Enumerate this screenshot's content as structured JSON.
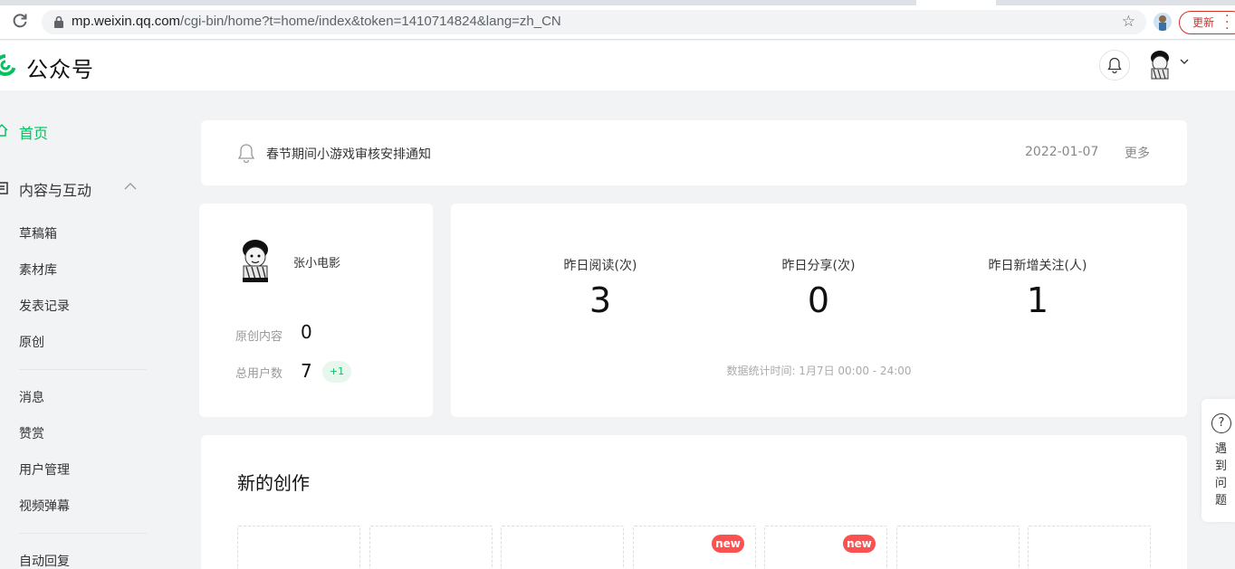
{
  "browser": {
    "url_host": "mp.weixin.qq.com",
    "url_rest": "/cgi-bin/home?t=home/index&token=1410714824&lang=zh_CN",
    "update_label": "更新"
  },
  "header": {
    "app_name": "公众号"
  },
  "sidebar": {
    "home": "首页",
    "group_title": "内容与互动",
    "items_group1": [
      "草稿箱",
      "素材库",
      "发表记录",
      "原创"
    ],
    "items_group2": [
      "消息",
      "赞赏",
      "用户管理",
      "视频弹幕"
    ],
    "items_group3": [
      "自动回复"
    ]
  },
  "notice": {
    "title": "春节期间小游戏审核安排通知",
    "date": "2022-01-07",
    "more_label": "更多"
  },
  "account": {
    "name": "张小电影",
    "original_label": "原创内容",
    "original_value": "0",
    "users_label": "总用户数",
    "users_value": "7",
    "users_delta": "+1"
  },
  "stats": {
    "items": [
      {
        "label": "昨日阅读(次)",
        "value": "3"
      },
      {
        "label": "昨日分享(次)",
        "value": "0"
      },
      {
        "label": "昨日新增关注(人)",
        "value": "1"
      }
    ],
    "footnote": "数据统计时间: 1月7日 00:00 - 24:00"
  },
  "creation": {
    "title": "新的创作",
    "slots": [
      {
        "badge": ""
      },
      {
        "badge": ""
      },
      {
        "badge": ""
      },
      {
        "badge": "new"
      },
      {
        "badge": "new"
      },
      {
        "badge": ""
      },
      {
        "badge": ""
      }
    ]
  },
  "help": {
    "icon_text": "?",
    "label": "遇到问题"
  },
  "colors": {
    "accent": "#07c160",
    "badge_red": "#fa5151",
    "update_red": "#d93025"
  }
}
